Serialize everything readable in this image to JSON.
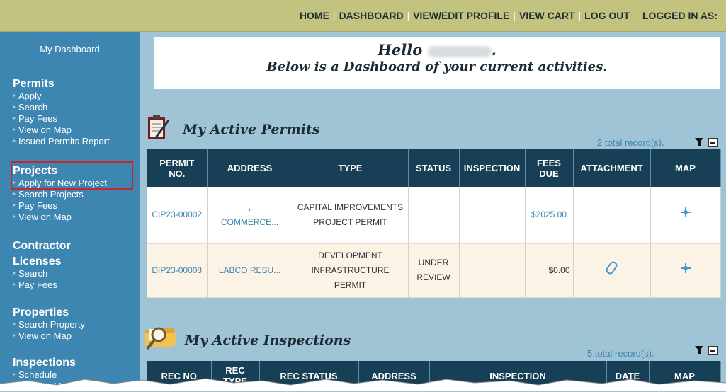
{
  "topnav": {
    "home": "HOME",
    "dashboard": "DASHBOARD",
    "profile": "VIEW/EDIT PROFILE",
    "cart": "VIEW CART",
    "logout": "LOG OUT",
    "logged_in": "LOGGED IN AS:",
    "separator": "|"
  },
  "sidebar": {
    "dashboard": "My Dashboard",
    "permits": {
      "title": "Permits",
      "items": [
        "Apply",
        "Search",
        "Pay Fees",
        "View on Map",
        "Issued Permits Report"
      ]
    },
    "projects": {
      "title": "Projects",
      "items": [
        "Apply for New Project",
        "Search Projects",
        "Pay Fees",
        "View on Map"
      ]
    },
    "contractor": {
      "title1": "Contractor",
      "title2": "Licenses",
      "items": [
        "Search",
        "Pay Fees"
      ]
    },
    "properties": {
      "title": "Properties",
      "items": [
        "Search Property",
        "View on Map"
      ]
    },
    "inspections": {
      "title": "Inspections",
      "items": [
        "Schedule",
        "View on Map"
      ]
    }
  },
  "welcome": {
    "hello": "Hello",
    "punct": ".",
    "subtitle": "Below is a Dashboard of your current activities."
  },
  "permits_section": {
    "title": "My Active Permits",
    "records": "2 total record(s).",
    "headers": [
      "PERMIT NO.",
      "ADDRESS",
      "TYPE",
      "STATUS",
      "INSPECTION",
      "FEES DUE",
      "ATTACHMENT",
      "MAP"
    ],
    "rows": [
      {
        "permit_no": "CIP23-00002",
        "address_top": ",",
        "address": "COMMERCE...",
        "type": "CAPITAL IMPROVEMENTS PROJECT PERMIT",
        "status": "",
        "inspection": "",
        "fees": "$2025.00",
        "attachment": "",
        "map": "move-icon"
      },
      {
        "permit_no": "DIP23-00008",
        "address_top": "",
        "address": "LABCO RESU...",
        "type": "DEVELOPMENT INFRASTRUCTURE PERMIT",
        "status": "UNDER REVIEW",
        "inspection": "",
        "fees": "$0.00",
        "attachment": "paperclip-icon",
        "map": "move-icon"
      }
    ]
  },
  "inspections_section": {
    "title": "My Active Inspections",
    "records": "5 total record(s).",
    "headers": [
      "REC NO",
      "REC TYPE",
      "REC STATUS",
      "ADDRESS",
      "INSPECTION",
      "DATE",
      "MAP"
    ]
  },
  "colors": {
    "topbar": "#c2c37e",
    "sidebar": "#3d86b1",
    "background": "#9fc4d6",
    "table_header": "#173f55",
    "link": "#3b85b0",
    "highlight_border": "#c6272e"
  }
}
